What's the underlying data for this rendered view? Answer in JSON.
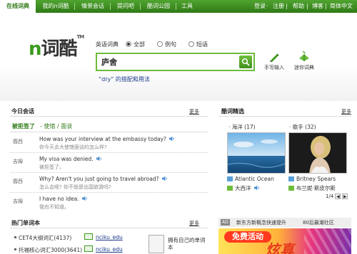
{
  "topnav": {
    "tabs": [
      "在线词典",
      "我的n词酷",
      "情景会话",
      "提问吧",
      "酷词公园",
      "工具"
    ],
    "right_links": [
      "登录",
      "注册",
      "帮助",
      "博客",
      "简体中文"
    ]
  },
  "header": {
    "logo_text": "词酷",
    "logo_n": "n",
    "logo_tm": "TM",
    "dict_label": "英语词典",
    "options": [
      "全部",
      "例句",
      "短语"
    ],
    "search_value": "庐舍",
    "hint": "“dry” 的搭配和用法",
    "tools": [
      "手写输入",
      "迷你词典"
    ]
  },
  "conversation": {
    "title": "今日会话",
    "more": "更多",
    "lead": "被拒签了",
    "sub": "- 使馆 / 面谈",
    "lines": [
      {
        "who": "霞西",
        "en": "How was your interview at the embassy today?",
        "cn": "你今天去大使馆面谈的怎么样?"
      },
      {
        "who": "吉姆",
        "en": "My visa was denied.",
        "cn": "被拒签了。"
      },
      {
        "who": "霞西",
        "en": "Why? Aren't you just going to travel abroad?",
        "cn": "怎么会呢? 你不就是出国旅游吗?"
      },
      {
        "who": "吉姆",
        "en": "I have no idea.",
        "cn": "我也不知道。"
      }
    ]
  },
  "hot_books": {
    "title": "热门单词本",
    "more": "更多",
    "rows": [
      {
        "name": "CET4大纲词汇(4137)",
        "user": "nciku_edu"
      },
      {
        "name": "托福核心词汇3000(3641)",
        "user": "nciku_edu"
      }
    ],
    "own_label": "拥有自己的单词本"
  },
  "featured": {
    "title": "酷词精选",
    "more": "更多",
    "cards": [
      {
        "label": "海洋",
        "count": "(17)",
        "en": "Atlantic Ocean",
        "cn": "大西洋"
      },
      {
        "label": "歌手",
        "count": "(32)",
        "en": "Britney Spears",
        "cn": "布兰妮·斯皮尔斯"
      }
    ],
    "pager": "1/4"
  },
  "ads": {
    "badge": "AD",
    "text1": "新东方新概念快速提升",
    "text2": "80后最潮社区",
    "banner_promo": "免费活动",
    "banner_big": "炫真"
  },
  "colors": {
    "brand_green": "#3a9a1c",
    "nav_green": "#2f7a16",
    "link_blue": "#1a3a8a"
  }
}
